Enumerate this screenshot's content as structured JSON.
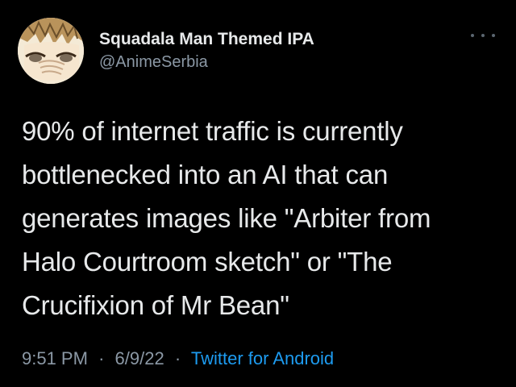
{
  "author": {
    "display_name": "Squadala Man Themed IPA",
    "handle": "@AnimeSerbia"
  },
  "tweet": {
    "lines": [
      "90% of internet traffic is currently",
      "bottlenecked into an AI that can",
      "generates images like \"Arbiter from",
      "Halo Courtroom sketch\" or \"The",
      "Crucifixion of Mr Bean\""
    ]
  },
  "meta": {
    "time": "9:51 PM",
    "separator": "·",
    "date": "6/9/22",
    "source": "Twitter for Android"
  },
  "icons": {
    "more": "more-options-icon",
    "avatar": "anime-character-avatar"
  },
  "colors": {
    "background": "#000000",
    "text": "#e7e9ea",
    "secondary": "#8b98a5",
    "link": "#1d9bf0"
  }
}
